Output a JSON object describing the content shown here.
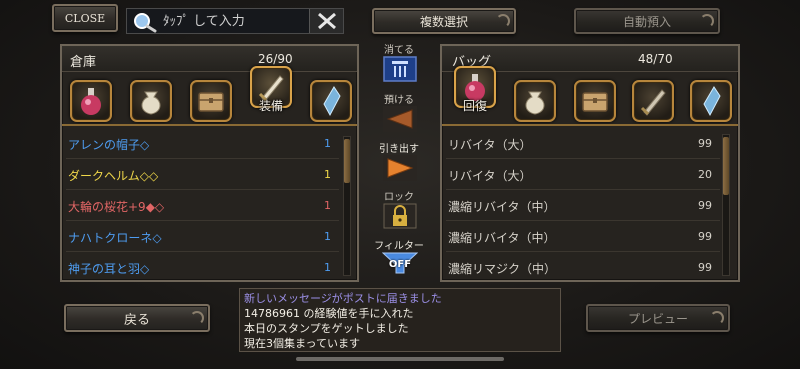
{
  "top": {
    "close_label": "CLOSE",
    "search_placeholder": "ﾀｯﾌﾟ して入力",
    "multi_select_label": "複数選択",
    "auto_deposit_label": "自動預入"
  },
  "warehouse": {
    "title": "倉庫",
    "count": "26/90",
    "categories": [
      {
        "icon": "potion-icon",
        "caption": ""
      },
      {
        "icon": "pouch-icon",
        "caption": ""
      },
      {
        "icon": "chest-icon",
        "caption": ""
      },
      {
        "icon": "equipment-icon",
        "caption": "装備"
      },
      {
        "icon": "crystal-icon",
        "caption": ""
      }
    ],
    "items": [
      {
        "name": "アレンの帽子◇",
        "qty": "1",
        "color": "#4e9cf0"
      },
      {
        "name": "ダークヘルム◇◇",
        "qty": "1",
        "color": "#f0d84a"
      },
      {
        "name": "大輪の桜花+9◆◇",
        "qty": "1",
        "color": "#e06565"
      },
      {
        "name": "ナハトクローネ◇",
        "qty": "1",
        "color": "#4e9cf0"
      },
      {
        "name": "神子の耳と羽◇",
        "qty": "1",
        "color": "#4e9cf0"
      }
    ]
  },
  "bag": {
    "title": "バッグ",
    "count": "48/70",
    "categories": [
      {
        "icon": "potion-icon",
        "caption": "回復"
      },
      {
        "icon": "pouch-icon",
        "caption": ""
      },
      {
        "icon": "chest-icon",
        "caption": ""
      },
      {
        "icon": "equipment-icon",
        "caption": ""
      },
      {
        "icon": "crystal-icon",
        "caption": ""
      }
    ],
    "items": [
      {
        "name": "リバイタ（大）",
        "qty": "99"
      },
      {
        "name": "リバイタ（大）",
        "qty": "20"
      },
      {
        "name": "濃縮リバイタ（中）",
        "qty": "99"
      },
      {
        "name": "濃縮リバイタ（中）",
        "qty": "99"
      },
      {
        "name": "濃縮リマジク（中）",
        "qty": "99"
      }
    ]
  },
  "middle": {
    "discard_label": "消てる",
    "deposit_label": "預ける",
    "withdraw_label": "引き出す",
    "lock_label": "ロック",
    "filter_label": "フィルター",
    "filter_state": "OFF"
  },
  "bottom": {
    "back_label": "戻る",
    "preview_label": "プレビュー",
    "messages": [
      "新しいメッセージがポストに届きました",
      "14786961 の経験値を手に入れた",
      "本日のスタンプをゲットしました",
      "現在3個集まっています"
    ],
    "message_colors": [
      "#9b8fe6",
      "#f3efe6",
      "#f3efe6",
      "#f3efe6"
    ]
  },
  "colors": {
    "accent_gold": "#b7863c",
    "panel_border": "#6e6558",
    "filter_blue": "#4a8ae0"
  }
}
